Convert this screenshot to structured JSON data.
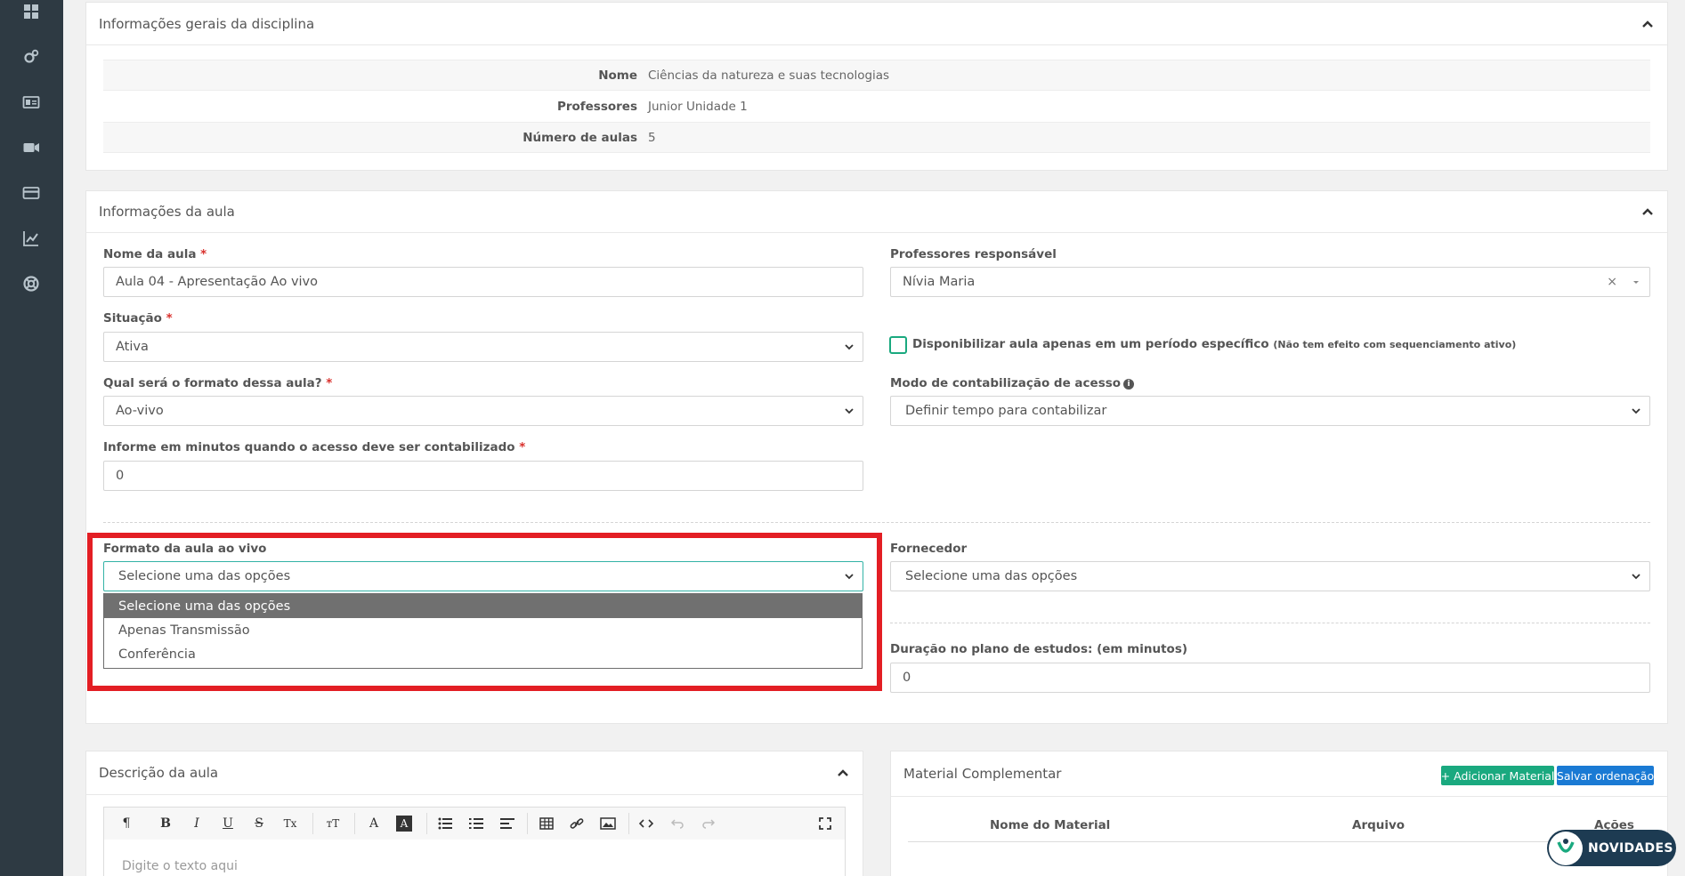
{
  "sidebar": {
    "icons": [
      "dashboard-icon",
      "settings-gears-icon",
      "id-card-icon",
      "video-camera-icon",
      "credit-card-icon",
      "line-chart-icon",
      "support-lifebuoy-icon"
    ]
  },
  "discipline_card": {
    "title": "Informações gerais da disciplina",
    "rows": [
      {
        "key": "Nome",
        "value": "Ciências da natureza e suas tecnologias"
      },
      {
        "key": "Professores",
        "value": "Junior Unidade 1"
      },
      {
        "key": "Número de aulas",
        "value": "5"
      }
    ]
  },
  "lesson_card": {
    "title": "Informações da aula",
    "lesson_name": {
      "label": "Nome da aula",
      "value": "Aula 04 - Apresentação Ao vivo"
    },
    "teachers": {
      "label": "Professores responsável",
      "value": "Nívia Maria",
      "clear": "×"
    },
    "status": {
      "label": "Situação",
      "value": "Ativa"
    },
    "period_checkbox": {
      "label": "Disponibilizar aula apenas em um período específico",
      "note": "(Não tem efeito com sequenciamento ativo)"
    },
    "format": {
      "label": "Qual será o formato dessa aula?",
      "value": "Ao-vivo"
    },
    "access_mode": {
      "label": "Modo de contabilização de acesso",
      "info": "i",
      "value": "Definir tempo para contabilizar"
    },
    "access_minutes": {
      "label": "Informe em minutos quando o acesso deve ser contabilizado",
      "value": "0"
    },
    "live_format": {
      "label": "Formato da aula ao vivo",
      "value": "Selecione uma das opções",
      "options": [
        "Selecione uma das opções",
        "Apenas Transmissão",
        "Conferência"
      ],
      "selected_index": 0
    },
    "supplier": {
      "label": "Fornecedor",
      "value": "Selecione uma das opções"
    },
    "study_duration": {
      "label": "Duração no plano de estudos: (em minutos)",
      "value": "0"
    },
    "required_mark": "*"
  },
  "description_card": {
    "title": "Descrição da aula",
    "toolbar": {
      "paragraph": "¶",
      "bold": "B",
      "italic": "I",
      "underline": "U",
      "strike": "S",
      "clear": "Tx",
      "font_size": "тT",
      "font_color": "A",
      "bg_color": "A"
    },
    "placeholder": "Digite o texto aqui"
  },
  "material_card": {
    "title": "Material Complementar",
    "add_button": "+ Adicionar Material",
    "save_order_button": "Salvar ordenação",
    "columns": [
      "Nome do Material",
      "Arquivo",
      "Ações"
    ]
  },
  "novidades": {
    "label": "NOVIDADES"
  },
  "colors": {
    "sidebar": "#2e3a43",
    "accent_green": "#1aa97f",
    "accent_blue": "#1a7ad4",
    "highlight_red": "#e31e24"
  }
}
